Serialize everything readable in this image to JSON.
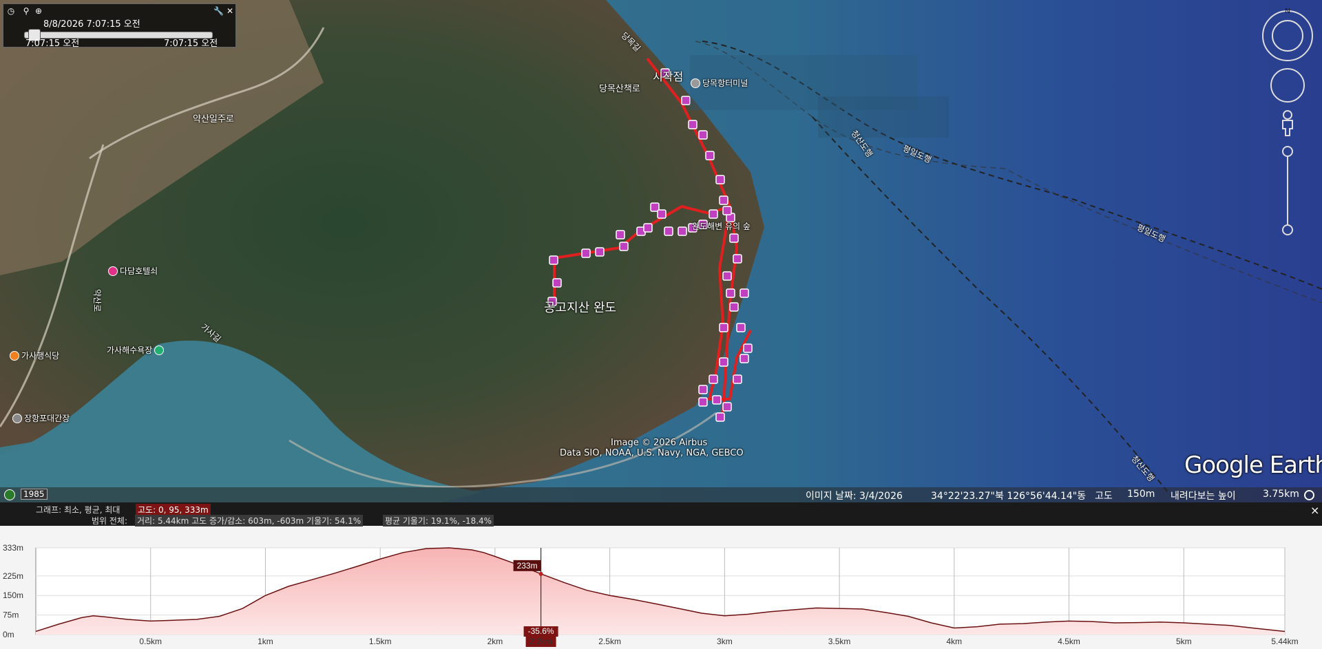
{
  "time_panel": {
    "top_datetime": "8/8/2026   7:07:15 오전",
    "start_time": "7:07:15 오전",
    "end_time": "7:07:15 오전",
    "icons": {
      "clock": "clock-icon",
      "zoom_out": "zoom-out-icon",
      "zoom_in": "zoom-in-icon",
      "wrench": "wrench-icon",
      "close": "close-icon"
    }
  },
  "map_labels": {
    "peak": "공고지산 완도",
    "trail_east": "완도해변 유의 숲",
    "poi_top": "당목항터미널",
    "poi_ticket": "당목산책로",
    "poi_north": "시작점",
    "poi_road": "약산일주로",
    "poi_hotel": "다담호텔쇠",
    "poi_cafe": "가사해수욕장",
    "poi_food": "가사행식당",
    "poi_fish": "장항포대간장",
    "road_vertical": "약산로",
    "coast_road": "가사길",
    "ferry1": "청산도행",
    "ferry2": "평일도행",
    "ferry3": "평일도행",
    "ferry4": "청산도행",
    "pier": "당목길",
    "copyright1": "Image © 2026 Airbus",
    "copyright2": "Data SIO, NOAA, U.S. Navy, NGA, GEBCO",
    "brand": "Google Earth",
    "compass_n": "N"
  },
  "statusbar": {
    "year_badge": "1985",
    "image_date": "이미지 날짜: 3/4/2026",
    "coords": "34°22'23.27\"북  126°56'44.14\"동",
    "altitude_label": "고도",
    "altitude_value": "150m",
    "eye_label": "내려다보는 높이",
    "eye_value": "3.75km"
  },
  "profile_header": {
    "graph_label": "그래프: 최소, 평균, 최대",
    "graph_value": "고도: 0, 95, 333m",
    "range_label": "범위 전체:",
    "range_stats": "거리: 5.44km  고도 증가/감소: 603m, -603m  기울기: 54.1%",
    "avg_slope": "평균 기울기: 19.1%, -18.4%",
    "close": "×"
  },
  "chart_data": {
    "type": "area",
    "title": "",
    "xlabel": "",
    "ylabel": "",
    "ylim": [
      0,
      333
    ],
    "xlim": [
      0,
      5.44
    ],
    "y_ticks": [
      "333m",
      "225m",
      "150m",
      "75m",
      "0m"
    ],
    "y_tick_values": [
      333,
      225,
      150,
      75,
      0
    ],
    "x_ticks": [
      "0.5km",
      "1km",
      "1.5km",
      "2km",
      "2.2km",
      "2.5km",
      "3km",
      "3.5km",
      "4km",
      "4.5km",
      "5km",
      "5.44km"
    ],
    "x_tick_values": [
      0.5,
      1,
      1.5,
      2,
      2.2,
      2.5,
      3,
      3.5,
      4,
      4.5,
      5,
      5.44
    ],
    "cursor": {
      "x": 2.2,
      "y": 233,
      "y_label": "233m",
      "slope_label": "-35.6%"
    },
    "series": [
      {
        "x": [
          0,
          0.1,
          0.2,
          0.25,
          0.3,
          0.4,
          0.5,
          0.6,
          0.7,
          0.8,
          0.9,
          1.0,
          1.1,
          1.2,
          1.3,
          1.4,
          1.5,
          1.6,
          1.7,
          1.8,
          1.9,
          1.95,
          2.0,
          2.1,
          2.2,
          2.3,
          2.4,
          2.5,
          2.6,
          2.7,
          2.8,
          2.9,
          3.0,
          3.1,
          3.2,
          3.3,
          3.4,
          3.5,
          3.6,
          3.7,
          3.8,
          3.9,
          4.0,
          4.1,
          4.2,
          4.3,
          4.4,
          4.5,
          4.6,
          4.7,
          4.8,
          4.9,
          5.0,
          5.1,
          5.2,
          5.3,
          5.44
        ],
        "y": [
          12,
          40,
          65,
          72,
          68,
          58,
          52,
          55,
          58,
          70,
          100,
          150,
          185,
          210,
          235,
          262,
          290,
          315,
          330,
          333,
          325,
          315,
          300,
          268,
          233,
          200,
          170,
          150,
          135,
          118,
          100,
          82,
          72,
          78,
          88,
          95,
          102,
          100,
          98,
          85,
          70,
          45,
          25,
          30,
          40,
          42,
          48,
          52,
          50,
          45,
          46,
          48,
          45,
          40,
          35,
          25,
          12
        ]
      }
    ]
  }
}
